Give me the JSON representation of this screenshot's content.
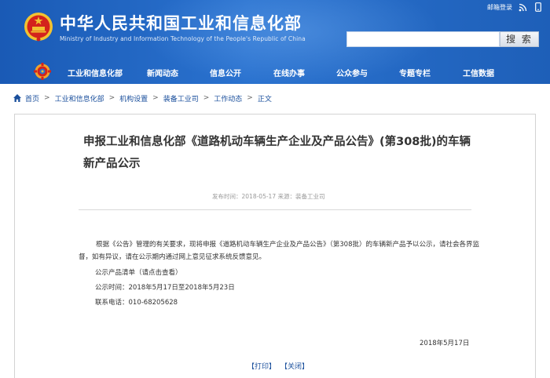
{
  "header": {
    "site_title": "中华人民共和国工业和信息化部",
    "site_subtitle": "Ministry of Industry and Information Technology of the People's Republic of China",
    "top_links": {
      "email_login": "邮箱登录"
    },
    "search": {
      "button_label": "搜 索",
      "placeholder": ""
    },
    "icons": [
      "emblem-icon",
      "rss-icon",
      "mobile-icon",
      "gear-logo-icon"
    ]
  },
  "nav": {
    "items": [
      {
        "label": "工业和信息化部"
      },
      {
        "label": "新闻动态"
      },
      {
        "label": "信息公开"
      },
      {
        "label": "在线办事"
      },
      {
        "label": "公众参与"
      },
      {
        "label": "专题专栏"
      },
      {
        "label": "工信数据"
      }
    ]
  },
  "breadcrumb": {
    "items": [
      "首页",
      "工业和信息化部",
      "机构设置",
      "装备工业司",
      "工作动态",
      "正文"
    ],
    "separator": ">"
  },
  "article": {
    "title": "申报工业和信息化部《道路机动车辆生产企业及产品公告》(第308批)的车辆新产品公示",
    "meta": {
      "publish_label": "发布时间：",
      "publish_date": "2018-05-17",
      "source_label": "来源：",
      "source": "装备工业司"
    },
    "paragraph": "根据《公告》管理的有关要求，现将申报《道路机动车辆生产企业及产品公告》（第308批）的车辆新产品予以公示，请社会各界监督，如有异议，请在公示期内通过网上意见征求系统反馈意见。",
    "lines": [
      "公示产品清单（请点击查看）",
      "公示时间：2018年5月17日至2018年5月23日",
      "联系电话：010-68205628"
    ],
    "sign_date": "2018年5月17日",
    "print_label": "【打印】",
    "close_label": "【关闭】"
  },
  "colors": {
    "header_blue": "#2a72cf",
    "link_blue": "#1a4f9c",
    "emblem_red": "#d3231c",
    "emblem_gold": "#f2c230"
  }
}
